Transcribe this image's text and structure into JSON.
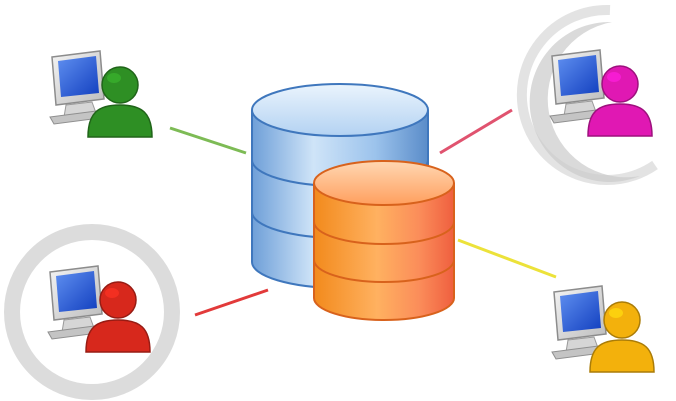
{
  "diagram": {
    "central": {
      "back_database": {
        "icon": "database-icon",
        "color": "#9fc6ee"
      },
      "front_database": {
        "icon": "database-icon",
        "color": "#f79a45"
      }
    },
    "clients": [
      {
        "id": "top-left",
        "icon": "user-computer-icon",
        "person_color": "#2e8f24",
        "link_color": "#7dbb55",
        "halo": false
      },
      {
        "id": "top-right",
        "icon": "user-computer-icon",
        "person_color": "#e018b3",
        "link_color": "#e0536f",
        "halo": true
      },
      {
        "id": "bottom-left",
        "icon": "user-computer-icon",
        "person_color": "#d7281c",
        "link_color": "#e23a3a",
        "halo": true
      },
      {
        "id": "bottom-right",
        "icon": "user-computer-icon",
        "person_color": "#f3b10c",
        "link_color": "#ece23a",
        "halo": false
      }
    ]
  }
}
